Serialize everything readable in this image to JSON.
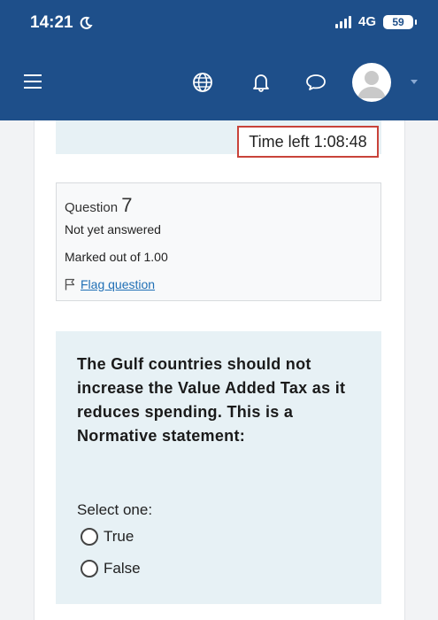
{
  "status_bar": {
    "time": "14:21",
    "network": "4G",
    "battery": "59"
  },
  "nav": {
    "icons": [
      "menu-icon",
      "globe-icon",
      "bell-icon",
      "chat-icon",
      "avatar",
      "chevron-down-icon"
    ]
  },
  "quiz": {
    "timer_text": "Time left 1:08:48",
    "question_label": "Question",
    "question_number": "7",
    "state": "Not yet answered",
    "marks": "Marked out of 1.00",
    "flag_label": "Flag question",
    "question_text": "The Gulf countries should not increase the Value Added Tax as it reduces spending. This is a Normative statement:",
    "prompt": "Select one:",
    "options": [
      {
        "label": "True"
      },
      {
        "label": "False"
      }
    ]
  },
  "colors": {
    "header": "#1e4f8a",
    "accent_link": "#1f6fb5",
    "timer_border": "#c9433a",
    "question_bg": "#e7f1f5"
  }
}
